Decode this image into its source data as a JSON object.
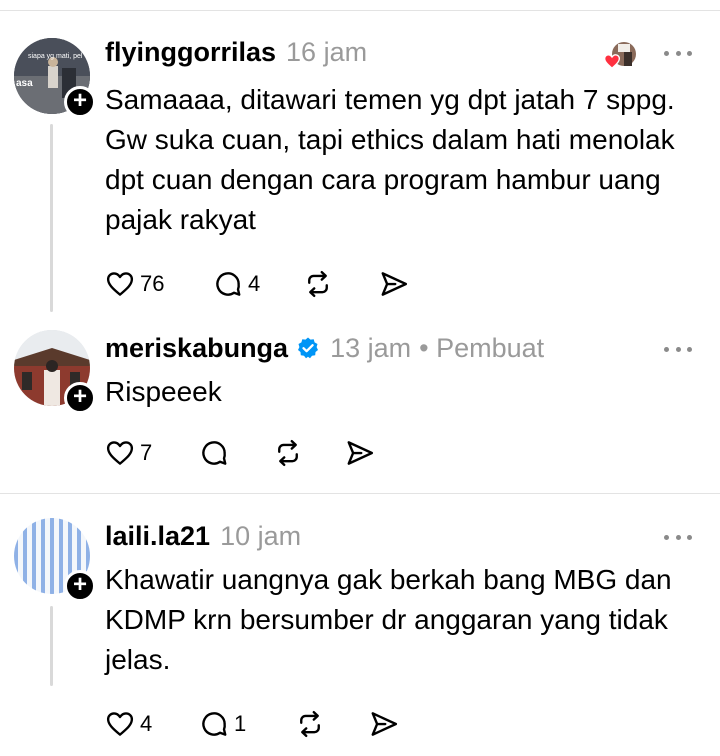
{
  "comments": [
    {
      "username": "flyinggorrilas",
      "time": "16 jam",
      "avatar_overlay_text": "siapa yg mati, pel",
      "avatar_side_text": "asa",
      "text": "Samaaaa, ditawari temen yg dpt jatah 7 sppg. Gw suka cuan, tapi ethics dalam hati menolak dpt cuan dengan cara program hambur uang pajak rakyat",
      "likes": "76",
      "replies": "4"
    },
    {
      "username": "meriskabunga",
      "time": "13 jam",
      "creator_label": "• Pembuat",
      "text": "Rispeeek",
      "likes": "7",
      "replies": ""
    },
    {
      "username": "laili.la21",
      "time": "10 jam",
      "text": "Khawatir uangnya gak berkah bang MBG dan KDMP krn bersumber dr anggaran yang tidak jelas.",
      "likes": "4",
      "replies": "1"
    }
  ],
  "icons": {
    "like": "heart-icon",
    "reply": "comment-icon",
    "repost": "repost-icon",
    "share": "send-icon",
    "more": "more-options-icon",
    "verified": "verified-badge-icon"
  },
  "colors": {
    "text": "#000000",
    "meta": "#9a9a9a",
    "verified": "#0095f6",
    "liked_heart": "#ff3040",
    "divider": "#e3e3e3"
  }
}
